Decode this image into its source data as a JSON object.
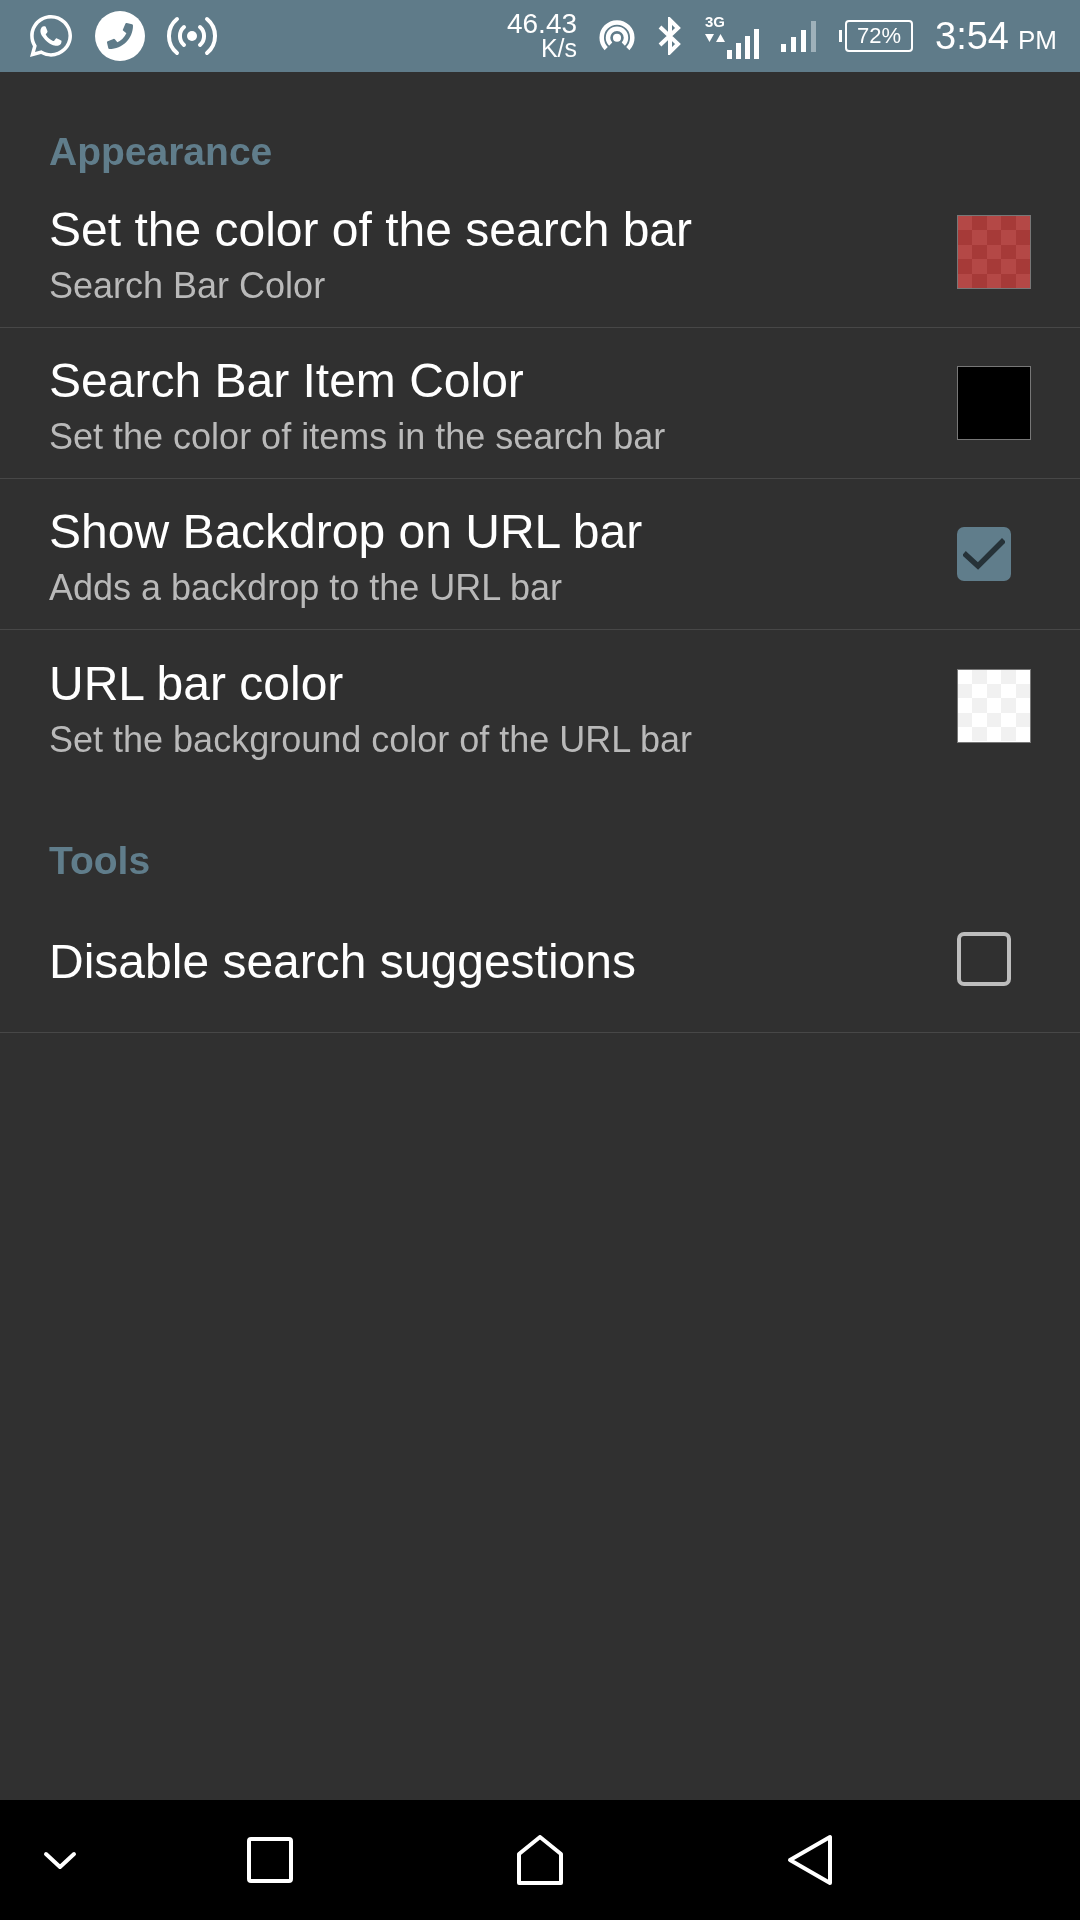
{
  "status_bar": {
    "net_speed": "46.43",
    "net_speed_unit": "K/s",
    "network_type": "3G",
    "battery": "72%",
    "time": "3:54",
    "time_period": "PM"
  },
  "sections": [
    {
      "title": "Appearance",
      "items": [
        {
          "kind": "color",
          "title": "Set the color of the search bar",
          "summary": "Search Bar Color",
          "color": "#b44846",
          "translucent": true
        },
        {
          "kind": "color",
          "title": "Search Bar Item Color",
          "summary": "Set the color of items in the search bar",
          "color": "#000000",
          "translucent": false
        },
        {
          "kind": "checkbox",
          "title": "Show Backdrop on URL bar",
          "summary": "Adds a backdrop to the URL bar",
          "checked": true
        },
        {
          "kind": "color",
          "title": "URL bar color",
          "summary": "Set the background color of the URL bar",
          "color": "#ffffff",
          "translucent": true
        }
      ]
    },
    {
      "title": "Tools",
      "items": [
        {
          "kind": "checkbox",
          "title": "Disable search suggestions",
          "checked": false
        }
      ]
    }
  ]
}
